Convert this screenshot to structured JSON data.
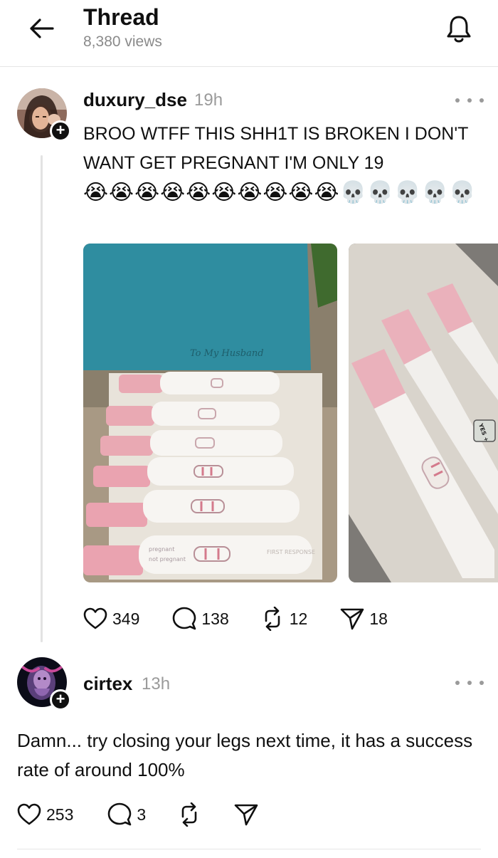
{
  "header": {
    "title": "Thread",
    "views": "8,380 views"
  },
  "post": {
    "username": "duxury_dse",
    "time": "19h",
    "text": "BROO WTFF THIS SHH1T IS BROKEN I DON'T WANT GET PREGNANT I'M ONLY 19",
    "emojis": "😭😭😭😭😭😭😭😭😭😭💀💀💀💀💀",
    "image_text": {
      "card": "To My Husband",
      "pregnant": "pregnant",
      "not_pregnant": "not pregnant",
      "brand": "FIRST RESPONSE",
      "yes": "YES +"
    },
    "likes": "349",
    "replies": "138",
    "reposts": "12",
    "shares": "18"
  },
  "reply": {
    "username": "cirtex",
    "time": "13h",
    "text": "Damn... try closing your legs next time, it has a success rate of around 100%",
    "likes": "253",
    "replies": "3"
  },
  "icons": {
    "back": "arrow-left-icon",
    "bell": "bell-icon",
    "more": "more-dots-icon",
    "like": "heart-icon",
    "reply": "comment-icon",
    "repost": "repost-icon",
    "share": "send-icon",
    "follow": "plus-icon"
  },
  "colors": {
    "text": "#101010",
    "muted": "#9a9a9a",
    "divider": "#e6e6e6"
  }
}
